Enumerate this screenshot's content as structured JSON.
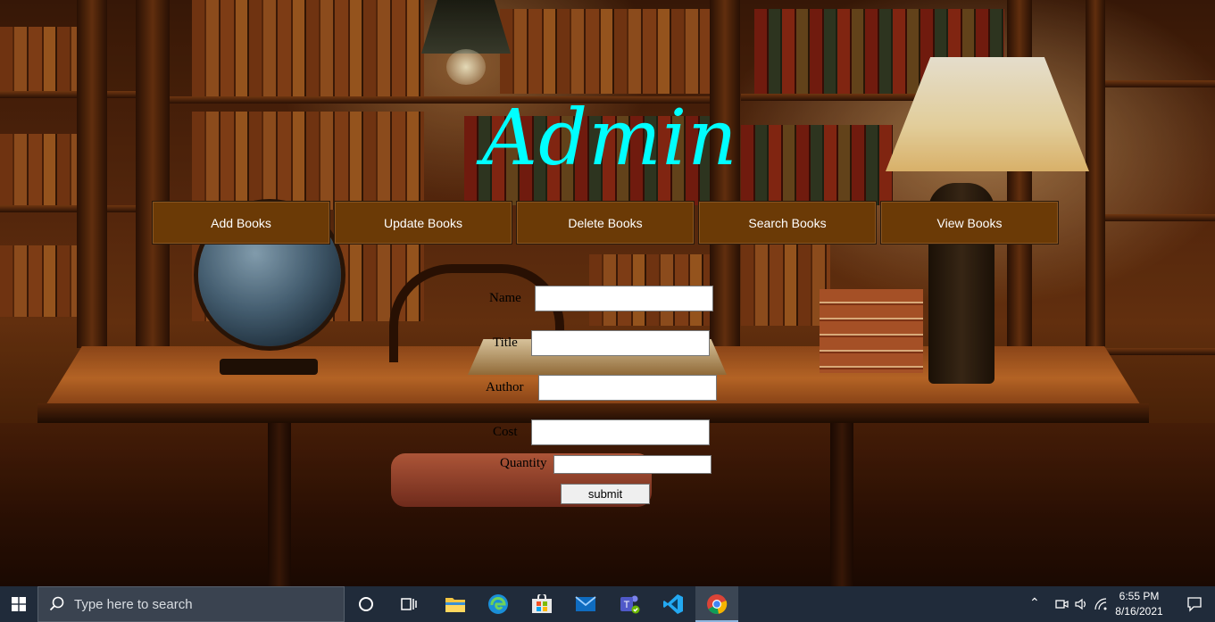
{
  "header": {
    "title": "Admin",
    "title_color": "#00ffff"
  },
  "nav": {
    "button_color": "#6b3a06",
    "items": [
      {
        "label": "Add Books"
      },
      {
        "label": "Update Books"
      },
      {
        "label": "Delete Books"
      },
      {
        "label": "Search Books"
      },
      {
        "label": "View Books"
      }
    ]
  },
  "form": {
    "fields": [
      {
        "label": "Name",
        "value": ""
      },
      {
        "label": "Title",
        "value": ""
      },
      {
        "label": "Author",
        "value": ""
      },
      {
        "label": "Cost",
        "value": ""
      },
      {
        "label": "Quantity",
        "value": ""
      }
    ],
    "submit_label": "submit"
  },
  "taskbar": {
    "search_placeholder": "Type here to search",
    "apps": [
      {
        "icon": "cortana-icon"
      },
      {
        "icon": "task-view-icon"
      },
      {
        "icon": "file-explorer-icon"
      },
      {
        "icon": "edge-icon"
      },
      {
        "icon": "microsoft-store-icon"
      },
      {
        "icon": "mail-icon"
      },
      {
        "icon": "teams-icon"
      },
      {
        "icon": "vscode-icon"
      },
      {
        "icon": "chrome-icon",
        "active": true
      }
    ],
    "clock": {
      "time": "6:55 PM",
      "date": "8/16/2021"
    }
  }
}
